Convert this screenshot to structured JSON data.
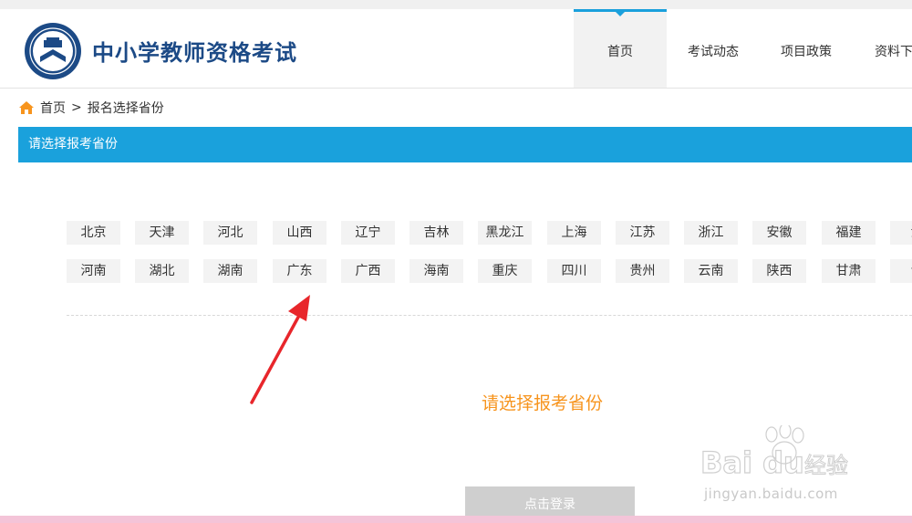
{
  "header": {
    "site_title": "中小学教师资格考试",
    "nav": [
      "首页",
      "考试动态",
      "项目政策",
      "资料下"
    ]
  },
  "breadcrumb": {
    "home": "首页",
    "separator": ">",
    "current": "报名选择省份"
  },
  "panel": {
    "title": "请选择报考省份"
  },
  "provinces": {
    "row1": [
      "北京",
      "天津",
      "河北",
      "山西",
      "辽宁",
      "吉林",
      "黑龙江",
      "上海",
      "江苏",
      "浙江",
      "安徽",
      "福建",
      "江"
    ],
    "row2": [
      "河南",
      "湖北",
      "湖南",
      "广东",
      "广西",
      "海南",
      "重庆",
      "四川",
      "贵州",
      "云南",
      "陕西",
      "甘肃",
      "青"
    ]
  },
  "prompt": "请选择报考省份",
  "login_button": "点击登录",
  "watermark": {
    "logo_text": "Bai du",
    "logo_cn": "经验",
    "url": "jingyan.baidu.com"
  },
  "colors": {
    "accent_blue": "#1aa1dc",
    "title_navy": "#1c4a86",
    "prompt_orange": "#f7941d",
    "annotation_red": "#e8262b"
  },
  "icons": [
    "emblem-logo-icon",
    "home-icon",
    "annotation-arrow-icon"
  ]
}
